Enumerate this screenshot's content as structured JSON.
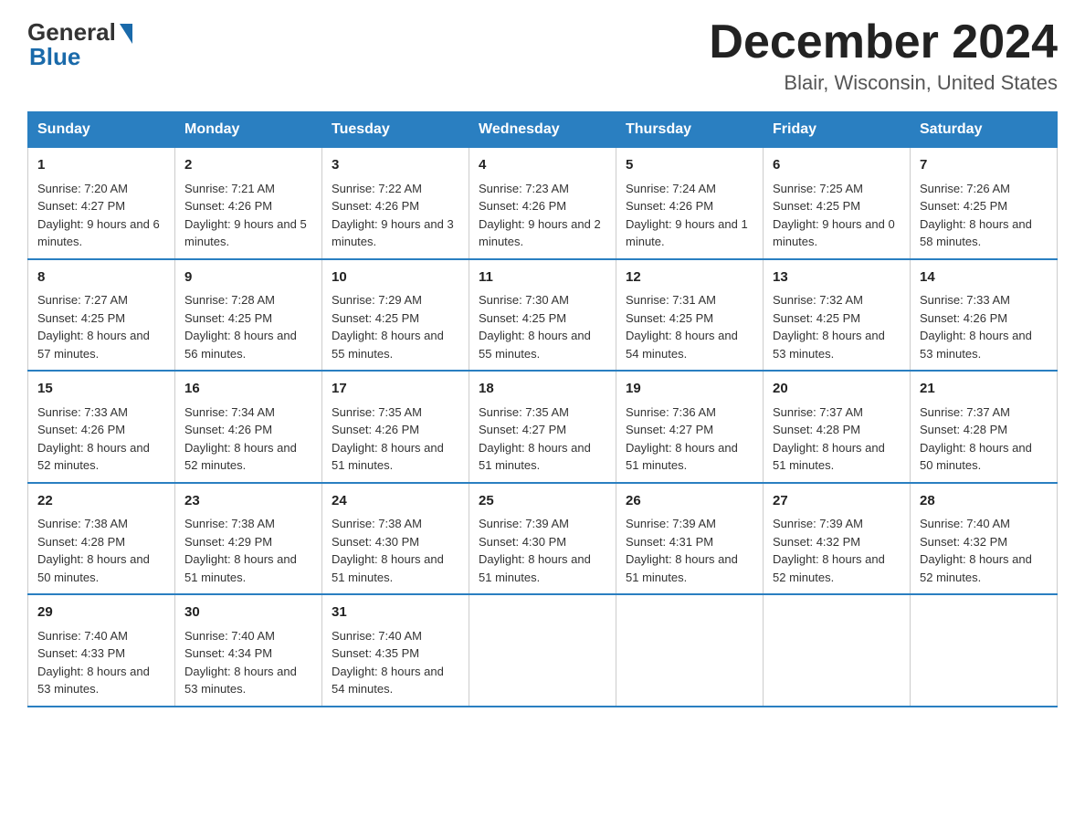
{
  "header": {
    "logo_text_general": "General",
    "logo_text_blue": "Blue",
    "month_year": "December 2024",
    "location": "Blair, Wisconsin, United States"
  },
  "days_of_week": [
    "Sunday",
    "Monday",
    "Tuesday",
    "Wednesday",
    "Thursday",
    "Friday",
    "Saturday"
  ],
  "weeks": [
    [
      {
        "day": "1",
        "sunrise": "7:20 AM",
        "sunset": "4:27 PM",
        "daylight": "9 hours and 6 minutes."
      },
      {
        "day": "2",
        "sunrise": "7:21 AM",
        "sunset": "4:26 PM",
        "daylight": "9 hours and 5 minutes."
      },
      {
        "day": "3",
        "sunrise": "7:22 AM",
        "sunset": "4:26 PM",
        "daylight": "9 hours and 3 minutes."
      },
      {
        "day": "4",
        "sunrise": "7:23 AM",
        "sunset": "4:26 PM",
        "daylight": "9 hours and 2 minutes."
      },
      {
        "day": "5",
        "sunrise": "7:24 AM",
        "sunset": "4:26 PM",
        "daylight": "9 hours and 1 minute."
      },
      {
        "day": "6",
        "sunrise": "7:25 AM",
        "sunset": "4:25 PM",
        "daylight": "9 hours and 0 minutes."
      },
      {
        "day": "7",
        "sunrise": "7:26 AM",
        "sunset": "4:25 PM",
        "daylight": "8 hours and 58 minutes."
      }
    ],
    [
      {
        "day": "8",
        "sunrise": "7:27 AM",
        "sunset": "4:25 PM",
        "daylight": "8 hours and 57 minutes."
      },
      {
        "day": "9",
        "sunrise": "7:28 AM",
        "sunset": "4:25 PM",
        "daylight": "8 hours and 56 minutes."
      },
      {
        "day": "10",
        "sunrise": "7:29 AM",
        "sunset": "4:25 PM",
        "daylight": "8 hours and 55 minutes."
      },
      {
        "day": "11",
        "sunrise": "7:30 AM",
        "sunset": "4:25 PM",
        "daylight": "8 hours and 55 minutes."
      },
      {
        "day": "12",
        "sunrise": "7:31 AM",
        "sunset": "4:25 PM",
        "daylight": "8 hours and 54 minutes."
      },
      {
        "day": "13",
        "sunrise": "7:32 AM",
        "sunset": "4:25 PM",
        "daylight": "8 hours and 53 minutes."
      },
      {
        "day": "14",
        "sunrise": "7:33 AM",
        "sunset": "4:26 PM",
        "daylight": "8 hours and 53 minutes."
      }
    ],
    [
      {
        "day": "15",
        "sunrise": "7:33 AM",
        "sunset": "4:26 PM",
        "daylight": "8 hours and 52 minutes."
      },
      {
        "day": "16",
        "sunrise": "7:34 AM",
        "sunset": "4:26 PM",
        "daylight": "8 hours and 52 minutes."
      },
      {
        "day": "17",
        "sunrise": "7:35 AM",
        "sunset": "4:26 PM",
        "daylight": "8 hours and 51 minutes."
      },
      {
        "day": "18",
        "sunrise": "7:35 AM",
        "sunset": "4:27 PM",
        "daylight": "8 hours and 51 minutes."
      },
      {
        "day": "19",
        "sunrise": "7:36 AM",
        "sunset": "4:27 PM",
        "daylight": "8 hours and 51 minutes."
      },
      {
        "day": "20",
        "sunrise": "7:37 AM",
        "sunset": "4:28 PM",
        "daylight": "8 hours and 51 minutes."
      },
      {
        "day": "21",
        "sunrise": "7:37 AM",
        "sunset": "4:28 PM",
        "daylight": "8 hours and 50 minutes."
      }
    ],
    [
      {
        "day": "22",
        "sunrise": "7:38 AM",
        "sunset": "4:28 PM",
        "daylight": "8 hours and 50 minutes."
      },
      {
        "day": "23",
        "sunrise": "7:38 AM",
        "sunset": "4:29 PM",
        "daylight": "8 hours and 51 minutes."
      },
      {
        "day": "24",
        "sunrise": "7:38 AM",
        "sunset": "4:30 PM",
        "daylight": "8 hours and 51 minutes."
      },
      {
        "day": "25",
        "sunrise": "7:39 AM",
        "sunset": "4:30 PM",
        "daylight": "8 hours and 51 minutes."
      },
      {
        "day": "26",
        "sunrise": "7:39 AM",
        "sunset": "4:31 PM",
        "daylight": "8 hours and 51 minutes."
      },
      {
        "day": "27",
        "sunrise": "7:39 AM",
        "sunset": "4:32 PM",
        "daylight": "8 hours and 52 minutes."
      },
      {
        "day": "28",
        "sunrise": "7:40 AM",
        "sunset": "4:32 PM",
        "daylight": "8 hours and 52 minutes."
      }
    ],
    [
      {
        "day": "29",
        "sunrise": "7:40 AM",
        "sunset": "4:33 PM",
        "daylight": "8 hours and 53 minutes."
      },
      {
        "day": "30",
        "sunrise": "7:40 AM",
        "sunset": "4:34 PM",
        "daylight": "8 hours and 53 minutes."
      },
      {
        "day": "31",
        "sunrise": "7:40 AM",
        "sunset": "4:35 PM",
        "daylight": "8 hours and 54 minutes."
      },
      null,
      null,
      null,
      null
    ]
  ]
}
